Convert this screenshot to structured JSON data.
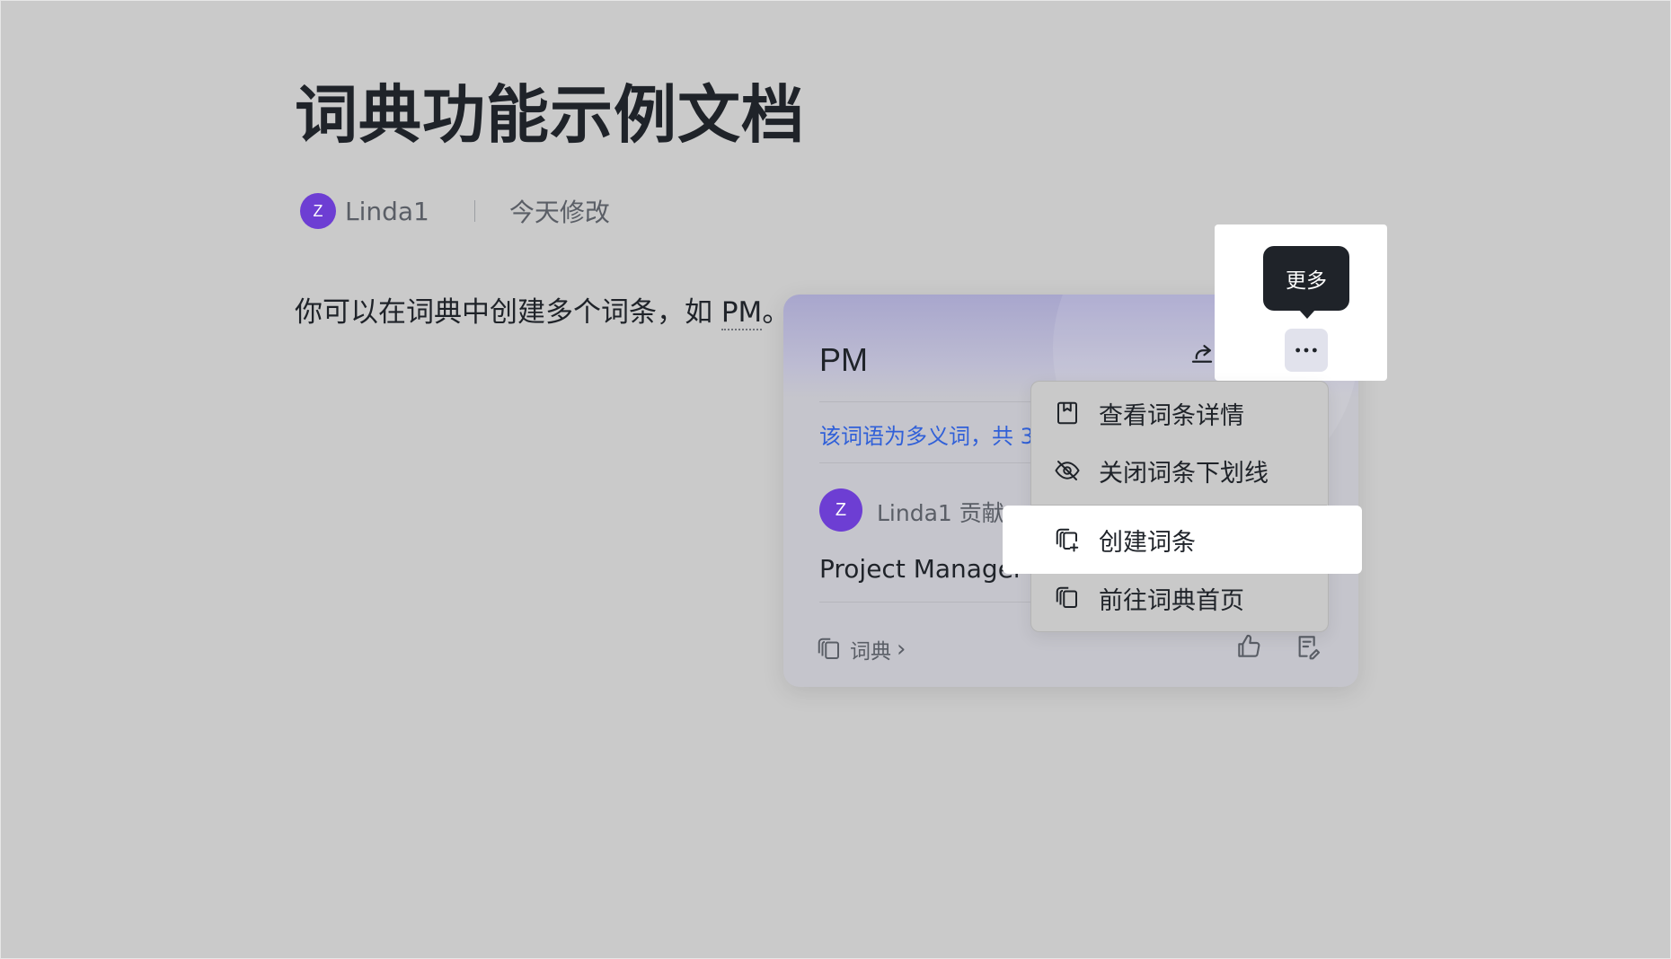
{
  "document": {
    "title": "词典功能示例文档",
    "author_initial": "Z",
    "author": "Linda1",
    "modified": "今天修改",
    "paragraph_prefix": "你可以在词典中创建多个词条，如 ",
    "paragraph_term": "PM",
    "paragraph_suffix": "。"
  },
  "card": {
    "term": "PM",
    "polysemy_note": "该词语为多义词，共 3",
    "contributor_initial": "Z",
    "contributor": "Linda1 贡献",
    "definition": "Project Manager 的",
    "footer_link": "词典",
    "footer_chevron": "›",
    "actions": {
      "share_icon": "share-icon",
      "edit_icon": "pencil-icon",
      "more_icon": "more-horizontal-icon"
    }
  },
  "tooltip": {
    "text": "更多"
  },
  "menu": {
    "items": [
      {
        "label": "查看词条详情",
        "icon": "bookmark-icon"
      },
      {
        "label": "关闭词条下划线",
        "icon": "eye-off-icon"
      },
      {
        "label": "创建词条",
        "icon": "dictionary-add-icon"
      },
      {
        "label": "前往词典首页",
        "icon": "dictionary-icon"
      }
    ]
  },
  "colors": {
    "avatar": "#6d3ed3",
    "link": "#3060d8",
    "tooltip_bg": "#1f2329",
    "highlight": "#ffffff"
  }
}
